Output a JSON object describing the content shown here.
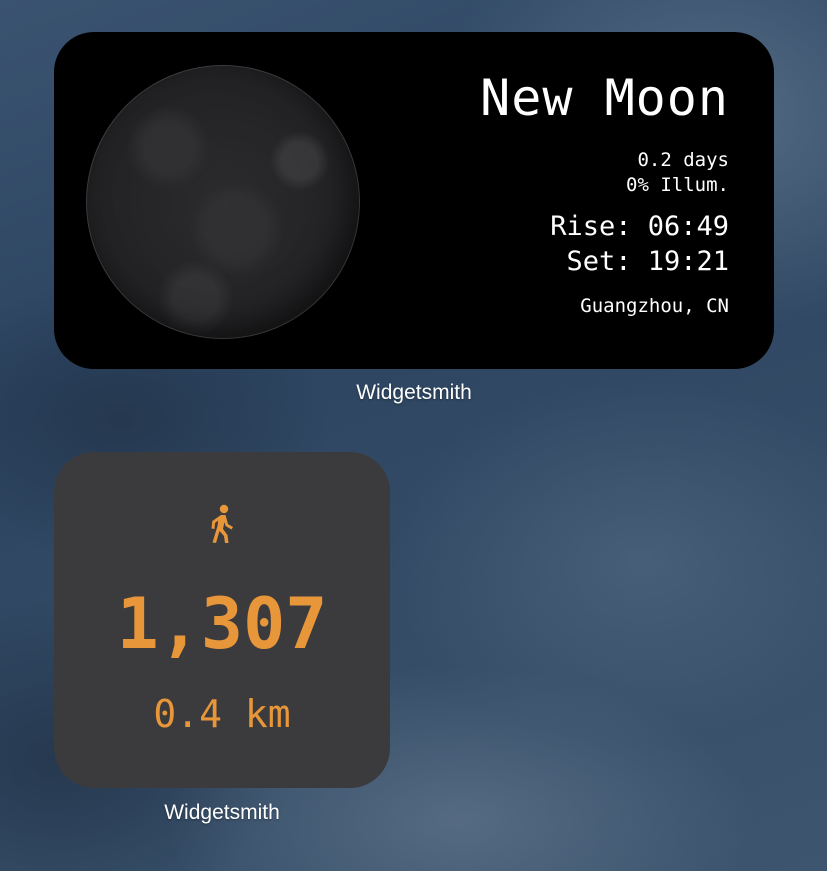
{
  "moon_widget": {
    "phase": "New Moon",
    "age": "0.2 days",
    "illumination": "0% Illum.",
    "rise": "Rise: 06:49",
    "set": "Set: 19:21",
    "location": "Guangzhou, CN",
    "caption": "Widgetsmith"
  },
  "steps_widget": {
    "icon": "walking-person-icon",
    "steps": "1,307",
    "distance": "0.4 km",
    "caption": "Widgetsmith",
    "accent_color": "#e8963a"
  },
  "colors": {
    "moon_widget_bg": "#000000",
    "steps_widget_bg": "#3b3b3d",
    "text_primary": "#ffffff"
  }
}
